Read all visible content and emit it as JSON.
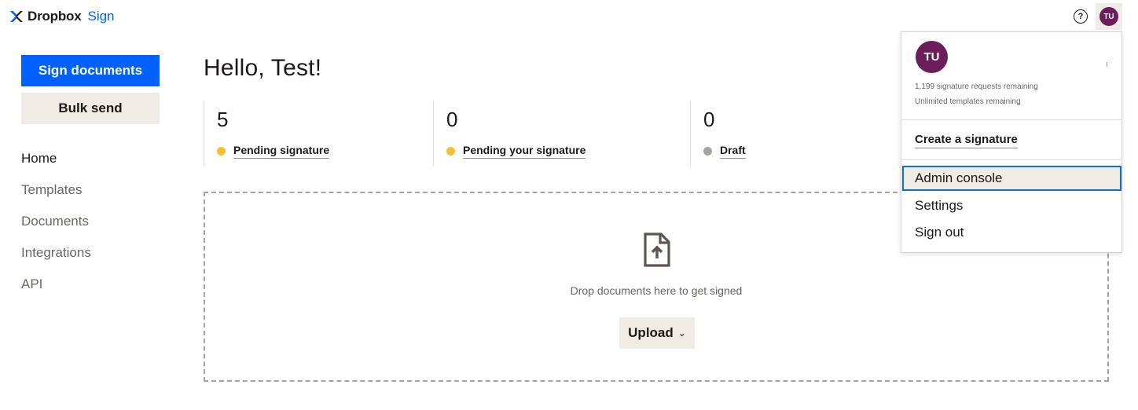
{
  "header": {
    "brand_name": "Dropbox",
    "brand_product": "Sign",
    "help_glyph": "?",
    "user_initials": "TU"
  },
  "sidebar": {
    "primary_button": "Sign documents",
    "secondary_button": "Bulk send",
    "nav": [
      {
        "label": "Home",
        "active": true
      },
      {
        "label": "Templates"
      },
      {
        "label": "Documents"
      },
      {
        "label": "Integrations"
      },
      {
        "label": "API"
      }
    ]
  },
  "main": {
    "greeting": "Hello, Test!",
    "stats": [
      {
        "count": "5",
        "label": "Pending signature",
        "dot_color": "#f7c033"
      },
      {
        "count": "0",
        "label": "Pending your signature",
        "dot_color": "#f7c033"
      },
      {
        "count": "0",
        "label": "Draft",
        "dot_color": "#a8a29f"
      }
    ],
    "dropzone": {
      "text": "Drop documents here to get signed",
      "upload_label": "Upload",
      "icon": "document-upload-icon"
    }
  },
  "user_menu": {
    "initials": "TU",
    "requests_remaining": "1,199 signature requests remaining",
    "templates_remaining": "Unlimited templates remaining",
    "create_signature": "Create a signature",
    "items": [
      {
        "label": "Admin console",
        "focused": true
      },
      {
        "label": "Settings"
      },
      {
        "label": "Sign out"
      }
    ]
  },
  "colors": {
    "accent": "#0061fe",
    "brand_beige": "#f0ebe5",
    "avatar": "#6b1e5a",
    "focus_ring": "#0f6fde"
  }
}
